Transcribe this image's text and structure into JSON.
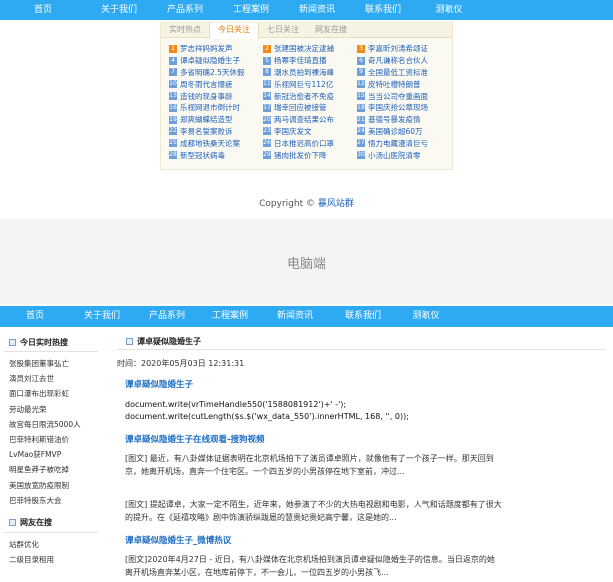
{
  "nav": [
    "首页",
    "关于我们",
    "产品系列",
    "工程案例",
    "新闻资讯",
    "联系我们",
    "测氡仪"
  ],
  "hot": {
    "tabs": [
      "实时热点",
      "今日关注",
      "七日关注",
      "网友在搜"
    ],
    "items": [
      {
        "n": "1",
        "t": "罗志祥妈妈发声"
      },
      {
        "n": "2",
        "t": "张建国被决定逮捕"
      },
      {
        "n": "3",
        "t": "李嘉昕刘涛希颂证"
      },
      {
        "n": "4",
        "t": "谭卓疑似隐婚生子"
      },
      {
        "n": "5",
        "t": "杨幂李佳琦直播"
      },
      {
        "n": "6",
        "t": "奇凡谦称名合伙人"
      },
      {
        "n": "7",
        "t": "多省明确2.5天休假"
      },
      {
        "n": "8",
        "t": "潮水员拍到裸海峰"
      },
      {
        "n": "9",
        "t": "全国最低工资标准"
      },
      {
        "n": "10",
        "t": "周冬雨代言爆疲"
      },
      {
        "n": "11",
        "t": "乐视网巨亏112亿"
      },
      {
        "n": "12",
        "t": "皮特吐槽特朗普"
      },
      {
        "n": "13",
        "t": "造钱的现身事龄"
      },
      {
        "n": "14",
        "t": "新冠治愈者不免疫"
      },
      {
        "n": "15",
        "t": "当当公司夺重画面"
      },
      {
        "n": "16",
        "t": "乐视网退市倒计时"
      },
      {
        "n": "17",
        "t": "瑞幸回应被接管"
      },
      {
        "n": "18",
        "t": "李国庆抢公章现场"
      },
      {
        "n": "19",
        "t": "郑爽蝴蝶结造型"
      },
      {
        "n": "20",
        "t": "两马调查结果公布"
      },
      {
        "n": "21",
        "t": "基德号暴发疫情"
      },
      {
        "n": "22",
        "t": "李易名誓案败诉"
      },
      {
        "n": "23",
        "t": "李国庆发文"
      },
      {
        "n": "24",
        "t": "美国确诊超60万"
      },
      {
        "n": "25",
        "t": "成都地铁桑天论案"
      },
      {
        "n": "26",
        "t": "日本推迟高价口罩"
      },
      {
        "n": "27",
        "t": "悟力电藏漫清巨亏"
      },
      {
        "n": "28",
        "t": "新型冠状病毒"
      },
      {
        "n": "29",
        "t": "猪肉批发价下降"
      },
      {
        "n": "30",
        "t": "小汤山医院清零"
      }
    ]
  },
  "copyright": {
    "prefix": "Copyright ©",
    "link": "暴风站群"
  },
  "band_label": "电脑端",
  "sidebar": {
    "title1": "今日实时热搜",
    "items1": [
      "张股集团董事弘亡",
      "演员刘江去世",
      "面口瀑布出现彩虹",
      "劳动最光荣",
      "故宫每日限流5000人",
      "巴菲特利斯错油价",
      "LvMao获FMVP",
      "明星鱼莽子被吃掉",
      "美国放宽防疫限制",
      "巴菲特股东大会"
    ],
    "title2": "网友在搜",
    "items2": [
      "站群优化",
      "二级目录租用"
    ]
  },
  "main": {
    "title": "谭卓疑似隐婚生子",
    "time": "时间：2020年05月03日 12:31:31",
    "h1": "谭卓疑似隐婚生子",
    "code1": "document.write(vrTimeHandle550('1588081912')+' -');",
    "code2": "document.write(cutLength($s.$('wx_data_550').innerHTML, 168, '', 0));",
    "h2": "谭卓疑似隐婚生子在线观看-搜狗视频",
    "p1a": "[图文] 最近，有八卦媒体证据表明在北京机场拍下了演员谭卓照片，就像他有了一个孩子一样。那天回到",
    "p1b": "京，她离开机场，直奔一个住宅区。一个四五岁的小男孩停在地下室前，冲过...",
    "p2a": "[图文] 提起谭卓，大家一定不陌生，近年来，她参演了不少的大热电视剧和电影，人气和话题度都有了很大",
    "p2b": "的提升。在《延禧攻略》剧中饰演骄纵跋扈的慧贵妃贵妃高宁馨，这是她的...",
    "h3": "谭卓疑似隐婚生子_微博热议",
    "p3a": "[图文]2020年4月27日 - 近日，有八卦媒体在北京机场拍到演员谭卓疑似隐婚生子的信息。当日返京的她",
    "p3b": "离开机场直奔某小区，在地库前停下，不一会儿，一位四五岁的小男孩飞..."
  }
}
